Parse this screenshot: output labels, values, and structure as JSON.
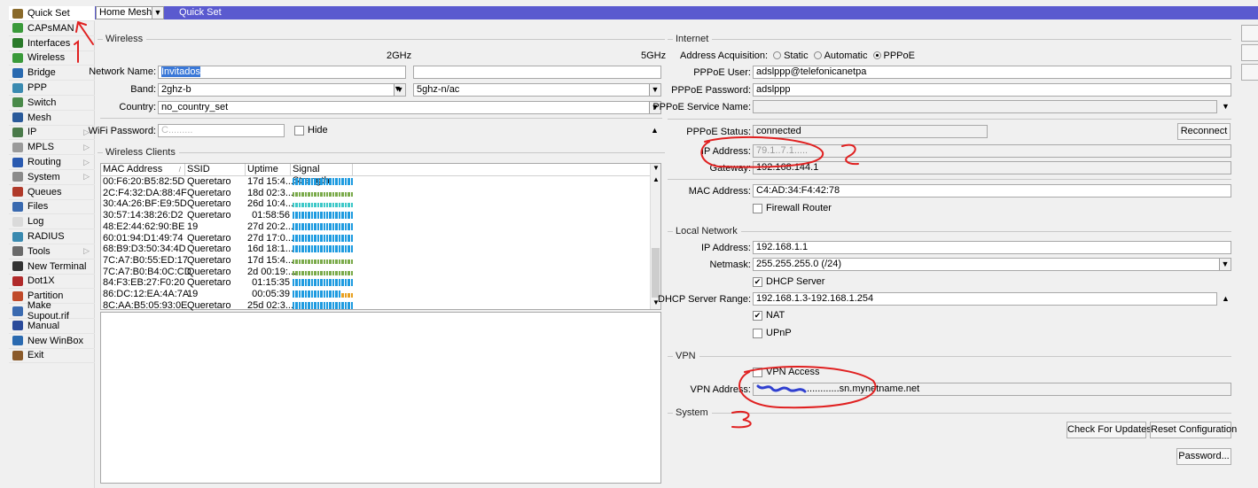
{
  "sidebar": {
    "items": [
      {
        "label": "Quick Set",
        "icon": "wand-icon",
        "color": "#8a6a2a",
        "active": true
      },
      {
        "label": "CAPsMAN",
        "icon": "antenna-icon",
        "color": "#3a9a3a"
      },
      {
        "label": "Interfaces",
        "icon": "interfaces-icon",
        "color": "#2a7a2a"
      },
      {
        "label": "Wireless",
        "icon": "wireless-icon",
        "color": "#3a9a3a"
      },
      {
        "label": "Bridge",
        "icon": "bridge-icon",
        "color": "#2a6ab0"
      },
      {
        "label": "PPP",
        "icon": "ppp-icon",
        "color": "#3a8ab0"
      },
      {
        "label": "Switch",
        "icon": "switch-icon",
        "color": "#4a8a4a"
      },
      {
        "label": "Mesh",
        "icon": "mesh-icon",
        "color": "#2a5a9a"
      },
      {
        "label": "IP",
        "icon": "ip-icon",
        "color": "#4a7a4a",
        "submenu": true
      },
      {
        "label": "MPLS",
        "icon": "mpls-icon",
        "color": "#9a9a9a",
        "submenu": true
      },
      {
        "label": "Routing",
        "icon": "routing-icon",
        "color": "#2a5ab0",
        "submenu": true
      },
      {
        "label": "System",
        "icon": "system-icon",
        "color": "#8a8a8a",
        "submenu": true
      },
      {
        "label": "Queues",
        "icon": "queues-icon",
        "color": "#b03a2a"
      },
      {
        "label": "Files",
        "icon": "files-icon",
        "color": "#3a6ab0"
      },
      {
        "label": "Log",
        "icon": "log-icon",
        "color": "#dadada"
      },
      {
        "label": "RADIUS",
        "icon": "radius-icon",
        "color": "#3a8ab0"
      },
      {
        "label": "Tools",
        "icon": "tools-icon",
        "color": "#6a6a6a",
        "submenu": true
      },
      {
        "label": "New Terminal",
        "icon": "terminal-icon",
        "color": "#333333"
      },
      {
        "label": "Dot1X",
        "icon": "dot1x-icon",
        "color": "#b02a2a"
      },
      {
        "label": "Partition",
        "icon": "partition-icon",
        "color": "#c04a2a"
      },
      {
        "label": "Make Supout.rif",
        "icon": "supout-icon",
        "color": "#3a6ab0"
      },
      {
        "label": "Manual",
        "icon": "manual-icon",
        "color": "#2a4a9a"
      },
      {
        "label": "New WinBox",
        "icon": "winbox-icon",
        "color": "#2a6ab0"
      },
      {
        "label": "Exit",
        "icon": "exit-icon",
        "color": "#8a5a2a"
      }
    ]
  },
  "header": {
    "mode": "Home Mesh",
    "title": "Quick Set",
    "bar_color": "#5a5acf"
  },
  "wireless": {
    "title": "Wireless",
    "col_2ghz": "2GHz",
    "col_5ghz": "5GHz",
    "network_name_label": "Network Name:",
    "network_name_2g": "Invitados",
    "network_name_5g": "",
    "band_label": "Band:",
    "band_2g": "2ghz-b",
    "band_5g": "5ghz-n/ac",
    "country_label": "Country:",
    "country": "no_country_set",
    "wifi_password_label": "WiFi Password:",
    "wifi_password": "C.........",
    "hide_label": "Hide"
  },
  "clients": {
    "title": "Wireless Clients",
    "columns": [
      "MAC Address",
      "SSID",
      "Uptime",
      "Signal Strength"
    ],
    "rows": [
      {
        "mac": "00:F6:20:B5:82:5D",
        "ssid": "Queretaro",
        "uptime": "17d 15:4...",
        "signal": "blue",
        "level": 1
      },
      {
        "mac": "2C:F4:32:DA:88:4F",
        "ssid": "Queretaro",
        "uptime": "18d 02:3...",
        "signal": "green",
        "level": 1
      },
      {
        "mac": "30:4A:26:BF:E9:5D",
        "ssid": "Queretaro",
        "uptime": "26d 10:4...",
        "signal": "teal",
        "level": 1
      },
      {
        "mac": "30:57:14:38:26:D2",
        "ssid": "Queretaro",
        "uptime": "01:58:56",
        "signal": "blue",
        "level": 1
      },
      {
        "mac": "48:E2:44:62:90:BE",
        "ssid": "19",
        "uptime": "27d 20:2...",
        "signal": "blue",
        "level": 1
      },
      {
        "mac": "60:01:94:D1:49:74",
        "ssid": "Queretaro",
        "uptime": "27d 17:0...",
        "signal": "blue",
        "level": 1
      },
      {
        "mac": "68:B9:D3:50:34:4D",
        "ssid": "Queretaro",
        "uptime": "16d 18:1...",
        "signal": "blue",
        "level": 1
      },
      {
        "mac": "7C:A7:B0:55:ED:17",
        "ssid": "Queretaro",
        "uptime": "17d 15:4...",
        "signal": "green",
        "level": 1
      },
      {
        "mac": "7C:A7:B0:B4:0C:CD",
        "ssid": "Queretaro",
        "uptime": "2d 00:19:...",
        "signal": "green",
        "level": 1
      },
      {
        "mac": "84:F3:EB:27:F0:20",
        "ssid": "Queretaro",
        "uptime": "01:15:35",
        "signal": "blue",
        "level": 1
      },
      {
        "mac": "86:DC:12:EA:4A:7A",
        "ssid": "19",
        "uptime": "00:05:39",
        "signal": "blue",
        "level": 0.8
      },
      {
        "mac": "8C:AA:B5:05:93:0E",
        "ssid": "Queretaro",
        "uptime": "25d 02:3...",
        "signal": "blue",
        "level": 1
      }
    ],
    "signal_colors": {
      "blue": "#1e9be0",
      "green": "#7aaa4a",
      "teal": "#3cc8c8",
      "weak": "#e8a020"
    }
  },
  "internet": {
    "title": "Internet",
    "acq_label": "Address Acquisition:",
    "acq_options": [
      "Static",
      "Automatic",
      "PPPoE"
    ],
    "acq_selected": "PPPoE",
    "user_label": "PPPoE User:",
    "user": "adslppp@telefonicanetpa",
    "password_label": "PPPoE Password:",
    "password": "adslppp",
    "service_label": "PPPoE Service Name:",
    "service": "",
    "status_label": "PPPoE Status:",
    "status": "connected",
    "reconnect": "Reconnect",
    "ip_label": "IP Address:",
    "ip": "79.1..7.1.....",
    "gateway_label": "Gateway:",
    "gateway": "192.168.144.1",
    "mac_label": "MAC Address:",
    "mac": "C4:AD:34:F4:42:78",
    "firewall_label": "Firewall Router",
    "firewall": false
  },
  "local": {
    "title": "Local Network",
    "ip_label": "IP Address:",
    "ip": "192.168.1.1",
    "netmask_label": "Netmask:",
    "netmask": "255.255.255.0 (/24)",
    "dhcp_label": "DHCP Server",
    "dhcp": true,
    "range_label": "DHCP Server Range:",
    "range": "192.168.1.3-192.168.1.254",
    "nat_label": "NAT",
    "nat": true,
    "upnp_label": "UPnP",
    "upnp": false
  },
  "vpn": {
    "title": "VPN",
    "access_label": "VPN Access",
    "access": false,
    "address_label": "VPN Address:",
    "address": "............sn.mynetname.net"
  },
  "system": {
    "title": "System",
    "check_updates": "Check For Updates",
    "reset": "Reset Configuration",
    "password": "Password..."
  },
  "annotation_color": "#e02020"
}
